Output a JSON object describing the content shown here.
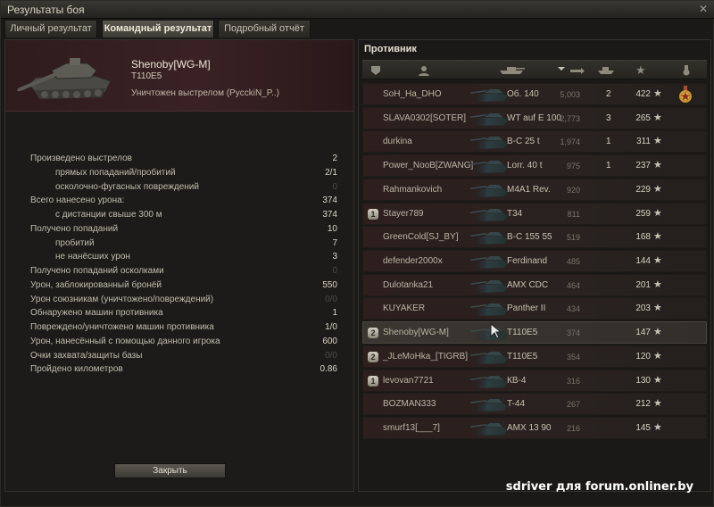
{
  "window": {
    "title": "Результаты боя",
    "close_glyph": "✕"
  },
  "tabs": [
    {
      "label": "Личный результат",
      "active": false
    },
    {
      "label": "Командный результат",
      "active": true
    },
    {
      "label": "Подробный отчёт",
      "active": false
    }
  ],
  "player": {
    "name": "Shenoby[WG-M]",
    "vehicle": "T110E5",
    "status": "Уничтожен выстрелом (PycckiN_P..)"
  },
  "stats": [
    {
      "label": "Произведено выстрелов",
      "value": "2",
      "dim": false
    },
    {
      "label": "прямых попаданий/пробитий",
      "value": "2/1",
      "dim": false
    },
    {
      "label": "осколочно-фугасных повреждений",
      "value": "0",
      "dim": true
    },
    {
      "label": "Всего нанесено урона:",
      "value": "374",
      "dim": false
    },
    {
      "label": "с дистанции свыше 300 м",
      "value": "374",
      "dim": false
    },
    {
      "label": "Получено попаданий",
      "value": "10",
      "dim": false
    },
    {
      "label": "пробитий",
      "value": "7",
      "dim": false
    },
    {
      "label": "не нанёсших урон",
      "value": "3",
      "dim": false
    },
    {
      "label": "Получено попаданий осколками",
      "value": "0",
      "dim": true
    },
    {
      "label": "Урон, заблокированный бронёй",
      "value": "550",
      "dim": false
    },
    {
      "label": "Урон союзникам (уничтожено/повреждений)",
      "value": "0/0",
      "dim": true
    },
    {
      "label": "Обнаружено машин противника",
      "value": "1",
      "dim": false
    },
    {
      "label": "Повреждено/уничтожено машин противника",
      "value": "1/0",
      "dim": false
    },
    {
      "label": "Урон, нанесённый с помощью данного игрока",
      "value": "600",
      "dim": false
    },
    {
      "label": "Очки захвата/защиты базы",
      "value": "0/0",
      "dim": true
    },
    {
      "label": "Пройдено километров",
      "value": "0.86",
      "dim": false
    }
  ],
  "close_button": {
    "label": "Закрыть"
  },
  "enemy_team": {
    "title": "Противник",
    "columns": [
      "squad-icon",
      "player-icon",
      "vehicle-icon",
      "damage-icon",
      "kills-icon",
      "xp-star-icon",
      "medal-icon"
    ],
    "rows": [
      {
        "squad": "",
        "name": "SoH_Ha_DHO",
        "vehicle": "Об. 140",
        "damage": "5,003",
        "kills": "2",
        "xp": "422",
        "medal": true,
        "me": false
      },
      {
        "squad": "",
        "name": "SLAVA0302[SOTER]",
        "vehicle": "WT auf E 100",
        "damage": "2,773",
        "kills": "3",
        "xp": "265",
        "medal": false,
        "me": false
      },
      {
        "squad": "",
        "name": "durkina",
        "vehicle": "B-C 25 t",
        "damage": "1,974",
        "kills": "1",
        "xp": "311",
        "medal": false,
        "me": false
      },
      {
        "squad": "",
        "name": "Power_NooB[ZWANG]",
        "vehicle": "Lorr. 40 t",
        "damage": "975",
        "kills": "1",
        "xp": "237",
        "medal": false,
        "me": false
      },
      {
        "squad": "",
        "name": "Rahmankovich",
        "vehicle": "M4A1 Rev.",
        "damage": "920",
        "kills": "",
        "xp": "229",
        "medal": false,
        "me": false
      },
      {
        "squad": "1",
        "name": "Stayer789",
        "vehicle": "T34",
        "damage": "811",
        "kills": "",
        "xp": "259",
        "medal": false,
        "me": false
      },
      {
        "squad": "",
        "name": "GreenCold[SJ_BY]",
        "vehicle": "B-C 155 55",
        "damage": "519",
        "kills": "",
        "xp": "168",
        "medal": false,
        "me": false
      },
      {
        "squad": "",
        "name": "defender2000x",
        "vehicle": "Ferdinand",
        "damage": "485",
        "kills": "",
        "xp": "144",
        "medal": false,
        "me": false
      },
      {
        "squad": "",
        "name": "Dulotanka21",
        "vehicle": "AMX CDC",
        "damage": "464",
        "kills": "",
        "xp": "201",
        "medal": false,
        "me": false
      },
      {
        "squad": "",
        "name": "KUYAKER",
        "vehicle": "Panther II",
        "damage": "434",
        "kills": "",
        "xp": "203",
        "medal": false,
        "me": false
      },
      {
        "squad": "2",
        "name": "Shenoby[WG-M]",
        "vehicle": "T110E5",
        "damage": "374",
        "kills": "",
        "xp": "147",
        "medal": false,
        "me": true
      },
      {
        "squad": "2",
        "name": "_JLeMoHka_[TIGRB]",
        "vehicle": "T110E5",
        "damage": "354",
        "kills": "",
        "xp": "120",
        "medal": false,
        "me": false
      },
      {
        "squad": "1",
        "name": "levovan7721",
        "vehicle": "КВ-4",
        "damage": "316",
        "kills": "",
        "xp": "130",
        "medal": false,
        "me": false
      },
      {
        "squad": "",
        "name": "BOZMAN333",
        "vehicle": "T-44",
        "damage": "267",
        "kills": "",
        "xp": "212",
        "medal": false,
        "me": false
      },
      {
        "squad": "",
        "name": "smurf13[___7]",
        "vehicle": "AMX 13 90",
        "damage": "216",
        "kills": "",
        "xp": "145",
        "medal": false,
        "me": false
      }
    ]
  },
  "watermark": "sdriver для forum.onliner.by"
}
